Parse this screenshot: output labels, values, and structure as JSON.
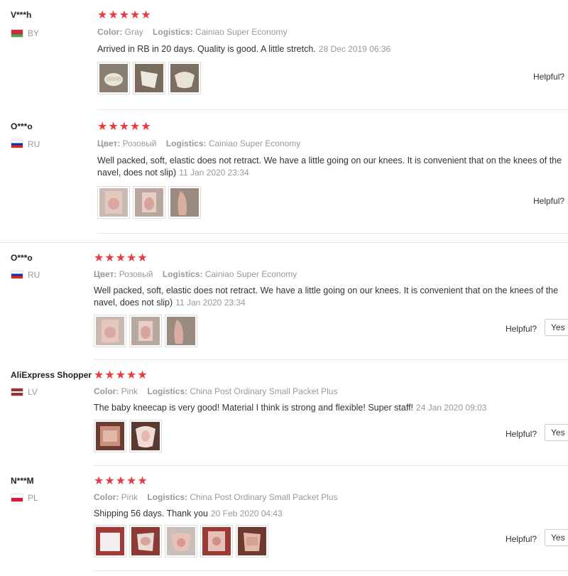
{
  "reviews": [
    {
      "user": "V***h",
      "country": "BY",
      "stars": "★★★★★",
      "meta1_key": "Color:",
      "meta1_val": "Gray",
      "meta2_key": "Logistics:",
      "meta2_val": "Cainiao Super Economy",
      "text": "Arrived in RB in 20 days. Quality is good. A little stretch.",
      "date": "28 Dec 2019 06:36",
      "helpful": "Helpful?",
      "photos": 3
    },
    {
      "user": "O***o",
      "country": "RU",
      "stars": "★★★★★",
      "meta1_key": "Цвет:",
      "meta1_val": "Розовый",
      "meta2_key": "Logistics:",
      "meta2_val": "Cainiao Super Economy",
      "text": "Well packed, soft, elastic does not retract. We have a little going on our knees. It is convenient that on the knees of the navel, does not slip)",
      "date": "11 Jan 2020 23:34",
      "helpful": "Helpful?",
      "photos": 3
    },
    {
      "user": "O***o",
      "country": "RU",
      "stars": "★★★★★",
      "meta1_key": "Цвет:",
      "meta1_val": "Розовый",
      "meta2_key": "Logistics:",
      "meta2_val": "Cainiao Super Economy",
      "text": "Well packed, soft, elastic does not retract. We have a little going on our knees. It is convenient that on the knees of the navel, does not slip)",
      "date": "11 Jan 2020 23:34",
      "helpful": "Helpful?",
      "yes": "Yes",
      "photos": 3
    },
    {
      "user": "AliExpress Shopper",
      "country": "LV",
      "stars": "★★★★★",
      "meta1_key": "Color:",
      "meta1_val": "Pink",
      "meta2_key": "Logistics:",
      "meta2_val": "China Post Ordinary Small Packet Plus",
      "text": "The baby kneecap is very good! Material I think is strong and flexible! Super staff!",
      "date": "24 Jan 2020 09:03",
      "helpful": "Helpful?",
      "yes": "Yes",
      "photos": 2
    },
    {
      "user": "N***M",
      "country": "PL",
      "stars": "★★★★★",
      "meta1_key": "Color:",
      "meta1_val": "Pink",
      "meta2_key": "Logistics:",
      "meta2_val": "China Post Ordinary Small Packet Plus",
      "text": "Shipping 56 days. Thank you",
      "date": "20 Feb 2020 04:43",
      "helpful": "Helpful?",
      "yes": "Yes",
      "photos": 5
    }
  ],
  "colors": {
    "star": "#e93b3d",
    "muted": "#999999"
  }
}
